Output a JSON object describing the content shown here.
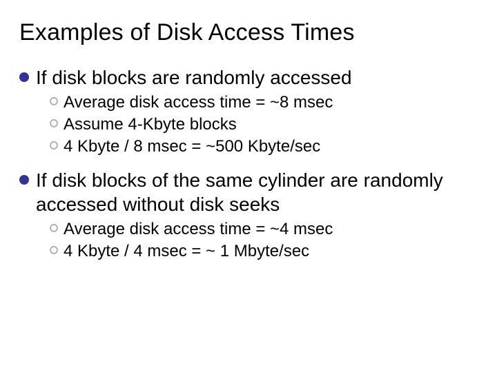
{
  "title": "Examples of Disk Access Times",
  "items": [
    {
      "text": "If disk blocks are randomly accessed",
      "sub": [
        "Average disk access time = ~8 msec",
        "Assume 4-Kbyte blocks",
        "4 Kbyte / 8 msec = ~500 Kbyte/sec"
      ]
    },
    {
      "text": "If disk blocks of the same cylinder are randomly accessed without disk seeks",
      "sub": [
        "Average disk access time = ~4 msec",
        "4 Kbyte / 4 msec = ~ 1 Mbyte/sec"
      ]
    }
  ]
}
